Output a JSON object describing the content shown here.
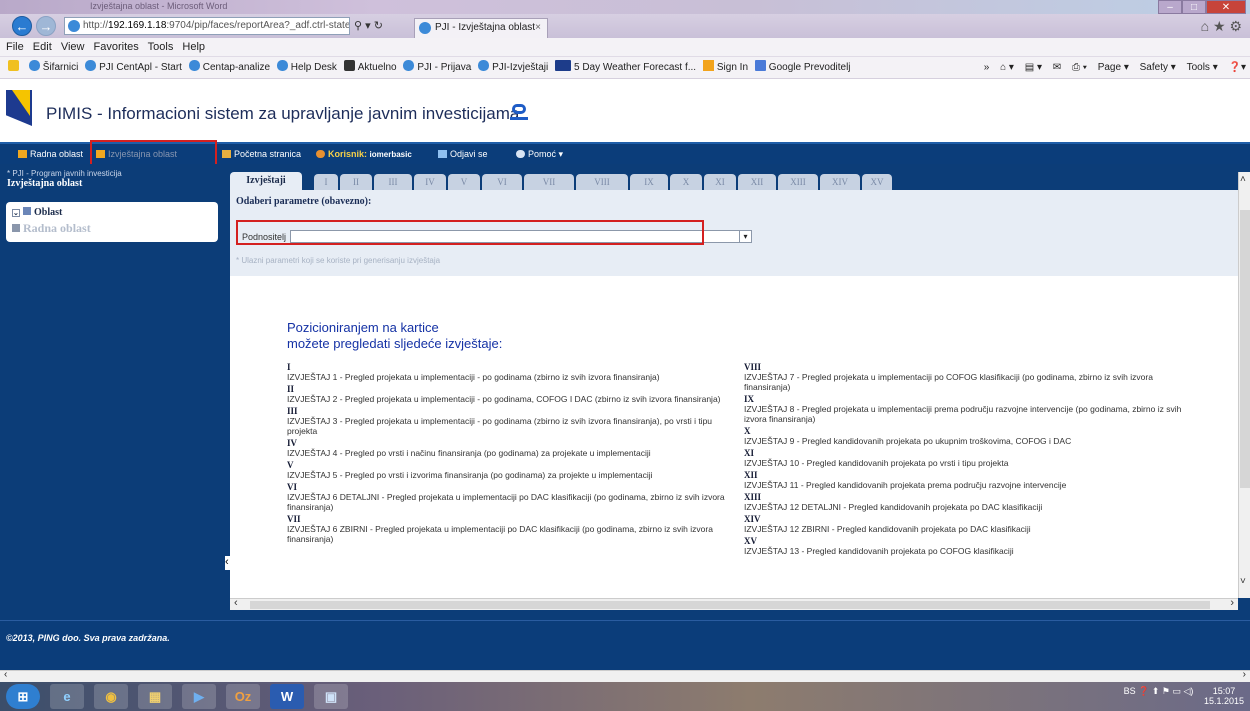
{
  "browser": {
    "window_title": "Izvještajna oblast - Microsoft Word",
    "address_prefix": "http://",
    "address_host": "192.169.1.18",
    "address_rest": ":9704/pip/faces/reportArea?_adf.ctrl-state=",
    "tab_title": "PJI - Izvještajna oblast",
    "tab_close": "×",
    "back": "←",
    "forward": "→",
    "addr_actions": "⚲ ▾ ↻",
    "right_icons": "⌂ ★ ⚙",
    "window_controls": {
      "minimize": "–",
      "maximize": "□",
      "close": "✕"
    },
    "menu": [
      "File",
      "Edit",
      "View",
      "Favorites",
      "Tools",
      "Help"
    ],
    "favorites": [
      "Šifarnici",
      "PJI CentApl - Start",
      "Centap-analize",
      "Help Desk",
      "Aktuelno",
      "PJI - Prijava",
      "PJI-Izvještaji",
      "5 Day Weather Forecast f...",
      "Sign In",
      "Google Prevoditelj"
    ],
    "fav_right": [
      "»",
      "⌂ ▾",
      "▤ ▾",
      "✉",
      "⎙ ▾",
      "Page ▾",
      "Safety ▾",
      "Tools ▾",
      "❓▾"
    ]
  },
  "app": {
    "title": "PIMIS - Informacioni sistem za upravljanje javnim investicijama",
    "nav": {
      "radna": "Radna oblast",
      "izvjestajna": "Izvještajna oblast",
      "pocetna": "Početna stranica",
      "korisnik_label": "Korisnik:",
      "korisnik_value": "iomerbasic",
      "odjavi": "Odjavi se",
      "pomoc": "Pomoć ▾"
    },
    "left": {
      "crumb": "* PJI - Program javnih investicija",
      "title": "Izvještajna oblast",
      "oblast": "Oblast",
      "radna": "Radna oblast"
    },
    "tabs": [
      "Izvještaji",
      "I",
      "II",
      "III",
      "IV",
      "V",
      "VI",
      "VII",
      "VIII",
      "IX",
      "X",
      "XI",
      "XII",
      "XIII",
      "XIV",
      "XV"
    ],
    "params_heading": "Odaberi parametre (obavezno):",
    "podnositelj_label": "Podnositelj",
    "podnositelj_value": "",
    "params_note": "* Ulazni parametri koji se koriste pri generisanju izvještaja",
    "intro_line1": "Pozicioniranjem na kartice",
    "intro_line2": "možete pregledati sljedeće izvještaje:",
    "reports_left": [
      {
        "num": "I",
        "desc": "IZVJEŠTAJ 1 - Pregled projekata u implementaciji - po godinama (zbirno iz svih izvora finansiranja)"
      },
      {
        "num": "II",
        "desc": "IZVJEŠTAJ 2 - Pregled projekata u implementaciji - po godinama, COFOG I DAC (zbirno iz svih izvora finansiranja)"
      },
      {
        "num": "III",
        "desc": "IZVJEŠTAJ 3 - Pregled projekata u implementaciji - po godinama (zbirno iz svih izvora finansiranja), po vrsti i tipu projekta"
      },
      {
        "num": "IV",
        "desc": "IZVJEŠTAJ 4 - Pregled po vrsti i načinu finansiranja (po godinama) za projekate u implementaciji"
      },
      {
        "num": "V",
        "desc": "IZVJEŠTAJ 5 - Pregled po vrsti i izvorima finansiranja (po godinama) za projekte u implementaciji"
      },
      {
        "num": "VI",
        "desc": "IZVJEŠTAJ 6 DETALJNI - Pregled projekata u implementaciji po DAC klasifikaciji (po godinama, zbirno iz svih izvora finansiranja)"
      },
      {
        "num": "VII",
        "desc": "IZVJEŠTAJ 6 ZBIRNI - Pregled projekata u implementaciji po DAC klasifikaciji (po godinama, zbirno iz svih izvora finansiranja)"
      }
    ],
    "reports_right": [
      {
        "num": "VIII",
        "desc": "IZVJEŠTAJ 7 - Pregled projekata u implementaciji po COFOG klasifikaciji (po godinama, zbirno iz svih izvora finansiranja)"
      },
      {
        "num": "IX",
        "desc": "IZVJEŠTAJ 8 - Pregled projekata u implementaciji prema području razvojne intervencije (po godinama, zbirno iz svih izvora finansiranja)"
      },
      {
        "num": "X",
        "desc": "IZVJEŠTAJ 9 - Pregled kandidovanih projekata po ukupnim troškovima, COFOG i DAC"
      },
      {
        "num": "XI",
        "desc": "IZVJEŠTAJ 10 - Pregled kandidovanih projekata po vrsti i tipu projekta"
      },
      {
        "num": "XII",
        "desc": "IZVJEŠTAJ 11 - Pregled kandidovanih projekata prema području razvojne intervencije"
      },
      {
        "num": "XIII",
        "desc": "IZVJEŠTAJ 12 DETALJNI - Pregled kandidovanih projekata po DAC klasifikaciji"
      },
      {
        "num": "XIV",
        "desc": "IZVJEŠTAJ 12 ZBIRNI - Pregled kandidovanih projekata po DAC klasifikaciji"
      },
      {
        "num": "XV",
        "desc": "IZVJEŠTAJ 13 - Pregled kandidovanih projekata po COFOG klasifikaciji"
      }
    ],
    "footer": "©2013, PING doo. Sva prava zadržana."
  },
  "taskbar": {
    "apps": [
      "⊞",
      "e",
      "◉",
      "▦",
      "▶",
      "Oz",
      "W",
      "▣"
    ],
    "lang": "BS",
    "time": "15:07",
    "date": "15.1.2015"
  },
  "colors": {
    "nav_bg": "#0b3d7a",
    "highlight_red": "#d42020",
    "link_blue": "#1532a5"
  }
}
